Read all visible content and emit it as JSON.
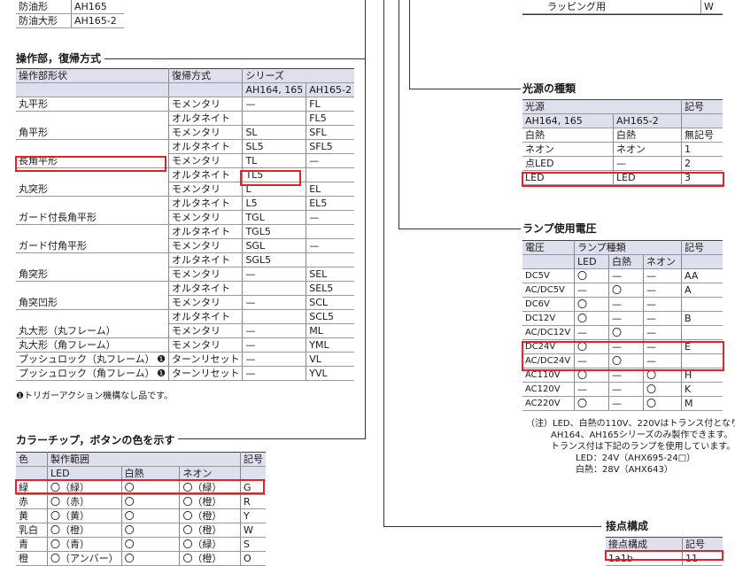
{
  "top_partial": {
    "rows": [
      [
        "防油形",
        "AH165"
      ],
      [
        "防油大形",
        "AH165-2"
      ]
    ],
    "right_row": [
      "ラッピング用",
      "W"
    ]
  },
  "sections": {
    "op": "操作部，復帰方式",
    "color": "カラーチップ，ボタンの色を示す",
    "light": "光源の種類",
    "volt": "ランプ使用電圧",
    "contact": "接点構成"
  },
  "op_table": {
    "h_shape": "操作部形状",
    "h_return": "復帰方式",
    "h_series": "シリーズ",
    "h_s1": "AH164, 165",
    "h_s2": "AH165-2",
    "rows": [
      [
        "丸平形",
        "モメンタリ",
        "—",
        "FL"
      ],
      [
        "",
        "オルタネイト",
        "",
        "FL5"
      ],
      [
        "角平形",
        "モメンタリ",
        "SL",
        "SFL"
      ],
      [
        "",
        "オルタネイト",
        "SL5",
        "SFL5"
      ],
      [
        "長角平形",
        "モメンタリ",
        "TL",
        "—"
      ],
      [
        "",
        "オルタネイト",
        "TL5",
        ""
      ],
      [
        "丸突形",
        "モメンタリ",
        "L",
        "EL"
      ],
      [
        "",
        "オルタネイト",
        "L5",
        "EL5"
      ],
      [
        "ガード付長角平形",
        "モメンタリ",
        "TGL",
        "—"
      ],
      [
        "",
        "オルタネイト",
        "TGL5",
        ""
      ],
      [
        "ガード付角平形",
        "モメンタリ",
        "SGL",
        "—"
      ],
      [
        "",
        "オルタネイト",
        "SGL5",
        ""
      ],
      [
        "角突形",
        "モメンタリ",
        "—",
        "SEL"
      ],
      [
        "",
        "オルタネイト",
        "",
        "SEL5"
      ],
      [
        "角突凹形",
        "モメンタリ",
        "—",
        "SCL"
      ],
      [
        "",
        "オルタネイト",
        "",
        "SCL5"
      ],
      [
        "丸大形（丸フレーム）",
        "モメンタリ",
        "—",
        "ML"
      ],
      [
        "丸大形（角フレーム）",
        "モメンタリ",
        "—",
        "YML"
      ],
      [
        "プッシュロック（丸フレーム）",
        "ターンリセット",
        "—",
        "VL"
      ],
      [
        "プッシュロック（角フレーム）",
        "ターンリセット",
        "—",
        "YVL"
      ]
    ],
    "mark": "❶",
    "footnote": "❶トリガーアクション機構なし品です。"
  },
  "color_table": {
    "h_color": "色",
    "h_range": "製作範囲",
    "h_code": "記号",
    "h_led": "LED",
    "h_inc": "白熱",
    "h_neon": "ネオン",
    "rows": [
      [
        "緑",
        "〇（緑）",
        "〇",
        "〇（緑）",
        "G"
      ],
      [
        "赤",
        "〇（赤）",
        "〇",
        "〇（橙）",
        "R"
      ],
      [
        "黄",
        "〇（黄）",
        "〇",
        "〇（橙）",
        "Y"
      ],
      [
        "乳白",
        "〇（橙）",
        "〇",
        "〇（橙）",
        "W"
      ],
      [
        "青",
        "〇（青）",
        "〇",
        "〇（緑）",
        "S"
      ],
      [
        "橙",
        "〇（アンバー）",
        "〇",
        "〇（橙）",
        "O"
      ]
    ]
  },
  "light_table": {
    "h_src": "光源",
    "h_code": "記号",
    "h_s1": "AH164, 165",
    "h_s2": "AH165-2",
    "rows": [
      [
        "白熱",
        "白熱",
        "無記号"
      ],
      [
        "ネオン",
        "ネオン",
        "1"
      ],
      [
        "点LED",
        "—",
        "2"
      ],
      [
        "LED",
        "LED",
        "3"
      ]
    ]
  },
  "volt_table": {
    "h_v": "電圧",
    "h_type": "ランプ種類",
    "h_code": "記号",
    "h_led": "LED",
    "h_inc": "白熱",
    "h_neon": "ネオン",
    "rows": [
      [
        "DC5V",
        "〇",
        "—",
        "—",
        "AA"
      ],
      [
        "AC/DC5V",
        "—",
        "〇",
        "—",
        "A"
      ],
      [
        "DC6V",
        "〇",
        "—",
        "—",
        ""
      ],
      [
        "DC12V",
        "〇",
        "—",
        "—",
        "B"
      ],
      [
        "AC/DC12V",
        "—",
        "〇",
        "—",
        ""
      ],
      [
        "DC24V",
        "〇",
        "—",
        "—",
        "E"
      ],
      [
        "AC/DC24V",
        "—",
        "〇",
        "—",
        ""
      ],
      [
        "AC110V",
        "〇",
        "—",
        "〇",
        "H"
      ],
      [
        "AC120V",
        "—",
        "—",
        "〇",
        "K"
      ],
      [
        "AC220V",
        "〇",
        "—",
        "〇",
        "M"
      ]
    ],
    "notes": [
      "（注）LED、白熱の110V、220Vはトランス付となり",
      "AH164、AH165シリーズのみ製作できます。",
      "トランス付は下記のランプを使用しています。",
      "LED：24V（AHX695-24□）",
      "白熱：28V（AHX643）"
    ]
  },
  "contact_table": {
    "h_c": "接点構成",
    "h_code": "記号",
    "rows": [
      [
        "1a1b",
        "11"
      ]
    ]
  }
}
